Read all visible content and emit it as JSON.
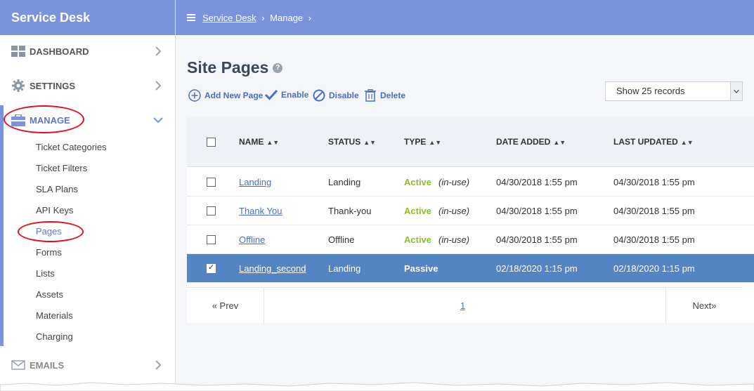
{
  "sidebar": {
    "brand": "Service Desk",
    "nav": [
      {
        "label": "DASHBOARD",
        "icon": "dashboard-icon"
      },
      {
        "label": "SETTINGS",
        "icon": "gear-icon"
      },
      {
        "label": "MANAGE",
        "icon": "briefcase-icon"
      },
      {
        "label": "EMAILS",
        "icon": "envelope-icon"
      }
    ],
    "manage_items": [
      "Ticket Categories",
      "Ticket Filters",
      "SLA Plans",
      "API Keys",
      "Pages",
      "Forms",
      "Lists",
      "Assets",
      "Materials",
      "Charging"
    ]
  },
  "header": {
    "breadcrumb": [
      "Service Desk",
      "Manage"
    ]
  },
  "main": {
    "title": "Site Pages",
    "help": "?",
    "toolbar": {
      "add": "Add New Page",
      "enable": "Enable",
      "disable": "Disable",
      "delete": "Delete"
    },
    "records_select": "Show 25 records",
    "table": {
      "columns": [
        "NAME",
        "STATUS",
        "TYPE",
        "DATE ADDED",
        "LAST UPDATED"
      ],
      "rows": [
        {
          "name": "Landing",
          "status": "Landing",
          "type": "Active",
          "inuse": "(in-use)",
          "date_added": "04/30/2018 1:55 pm",
          "last_updated": "04/30/2018 1:55 pm",
          "checked": false
        },
        {
          "name": "Thank You",
          "status": "Thank-you",
          "type": "Active",
          "inuse": "(in-use)",
          "date_added": "04/30/2018 1:55 pm",
          "last_updated": "04/30/2018 1:55 pm",
          "checked": false
        },
        {
          "name": "Offline",
          "status": "Offline",
          "type": "Active",
          "inuse": "(in-use)",
          "date_added": "04/30/2018 1:55 pm",
          "last_updated": "04/30/2018 1:55 pm",
          "checked": false
        },
        {
          "name": "Landing_second",
          "status": "Landing",
          "type": "Passive",
          "inuse": "",
          "date_added": "02/18/2020 1:15 pm",
          "last_updated": "02/18/2020 1:15 pm",
          "checked": true
        }
      ]
    },
    "pager": {
      "prev": "« Prev",
      "page": "1",
      "next": "Next»"
    }
  },
  "colors": {
    "header": "#7b93dd",
    "selected_row": "#5385c4",
    "active": "#8cbf26",
    "annotation": "#e0101b"
  }
}
